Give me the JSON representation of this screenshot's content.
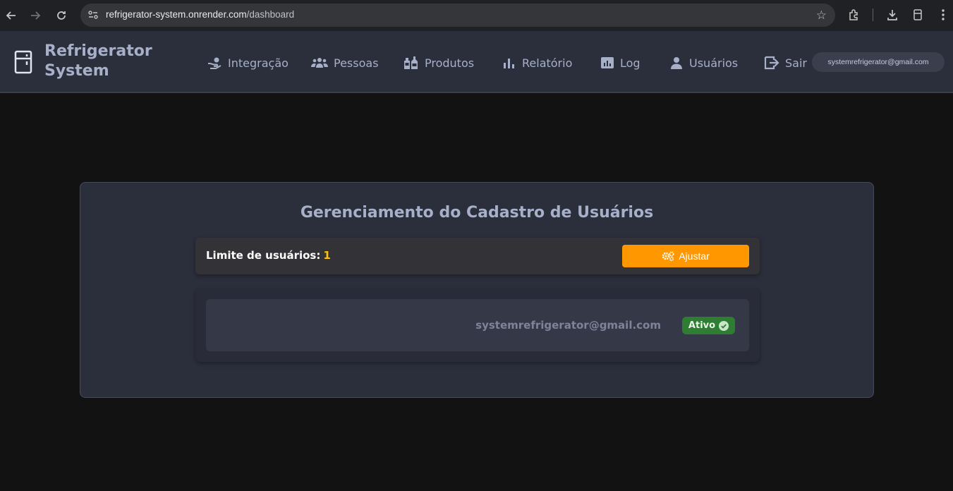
{
  "browser": {
    "url_host": "refrigerator-system.onrender.com",
    "url_path": "/dashboard"
  },
  "app": {
    "brand": "Refrigerator System",
    "menu": [
      {
        "label": "Integração",
        "icon": "hand-coin-icon"
      },
      {
        "label": "Pessoas",
        "icon": "people-group-icon"
      },
      {
        "label": "Produtos",
        "icon": "bottles-icon"
      },
      {
        "label": "Relatório",
        "icon": "bar-chart-icon"
      },
      {
        "label": "Log",
        "icon": "log-chart-icon"
      },
      {
        "label": "Usuários",
        "icon": "user-icon"
      },
      {
        "label": "Sair",
        "icon": "logout-icon"
      }
    ],
    "current_user_email": "systemrefrigerator@gmail.com"
  },
  "panel": {
    "title": "Gerenciamento do Cadastro de Usuários",
    "limit_label": "Limite de usuários:",
    "limit_value": "1",
    "adjust_label": "Ajustar",
    "users": [
      {
        "email": "systemrefrigerator@gmail.com",
        "status": "Ativo"
      }
    ]
  },
  "colors": {
    "accent": "#ff9800",
    "limit_value": "#ffc107",
    "status_active": "#2e7d32"
  }
}
